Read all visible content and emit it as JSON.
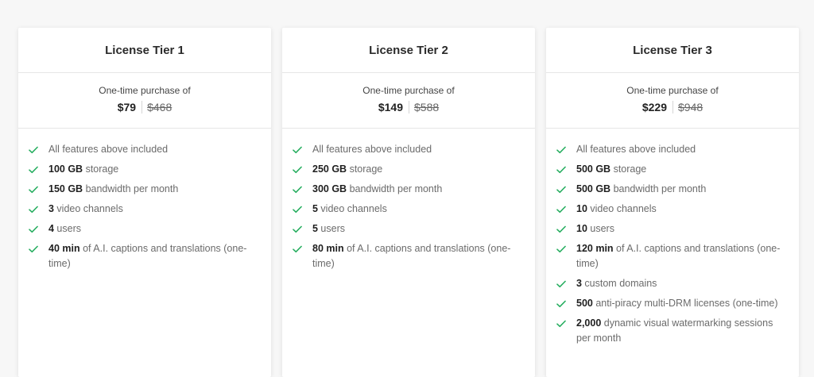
{
  "colors": {
    "check": "#27ae60"
  },
  "tiers": [
    {
      "title": "License Tier 1",
      "price_label": "One-time purchase of",
      "price": "$79",
      "old_price": "$468",
      "features": [
        {
          "strong": "",
          "text": "All features above included"
        },
        {
          "strong": "100 GB",
          "text": " storage"
        },
        {
          "strong": "150 GB",
          "text": " bandwidth per month"
        },
        {
          "strong": "3",
          "text": " video channels"
        },
        {
          "strong": "4",
          "text": " users"
        },
        {
          "strong": "40 min",
          "text": " of A.I. captions and translations (one-time)"
        }
      ]
    },
    {
      "title": "License Tier 2",
      "price_label": "One-time purchase of",
      "price": "$149",
      "old_price": "$588",
      "features": [
        {
          "strong": "",
          "text": "All features above included"
        },
        {
          "strong": "250 GB",
          "text": " storage"
        },
        {
          "strong": "300 GB",
          "text": " bandwidth per month"
        },
        {
          "strong": "5",
          "text": " video channels"
        },
        {
          "strong": "5",
          "text": " users"
        },
        {
          "strong": "80 min",
          "text": " of A.I. captions and translations (one-time)"
        }
      ]
    },
    {
      "title": "License Tier 3",
      "price_label": "One-time purchase of",
      "price": "$229",
      "old_price": "$948",
      "features": [
        {
          "strong": "",
          "text": "All features above included"
        },
        {
          "strong": "500 GB",
          "text": " storage"
        },
        {
          "strong": "500 GB",
          "text": " bandwidth per month"
        },
        {
          "strong": "10",
          "text": " video channels"
        },
        {
          "strong": "10",
          "text": " users"
        },
        {
          "strong": "120 min",
          "text": " of A.I. captions and translations (one-time)"
        },
        {
          "strong": "3",
          "text": " custom domains"
        },
        {
          "strong": "500",
          "text": " anti-piracy multi-DRM licenses (one-time)"
        },
        {
          "strong": "2,000",
          "text": " dynamic visual watermarking sessions per month"
        }
      ]
    }
  ]
}
